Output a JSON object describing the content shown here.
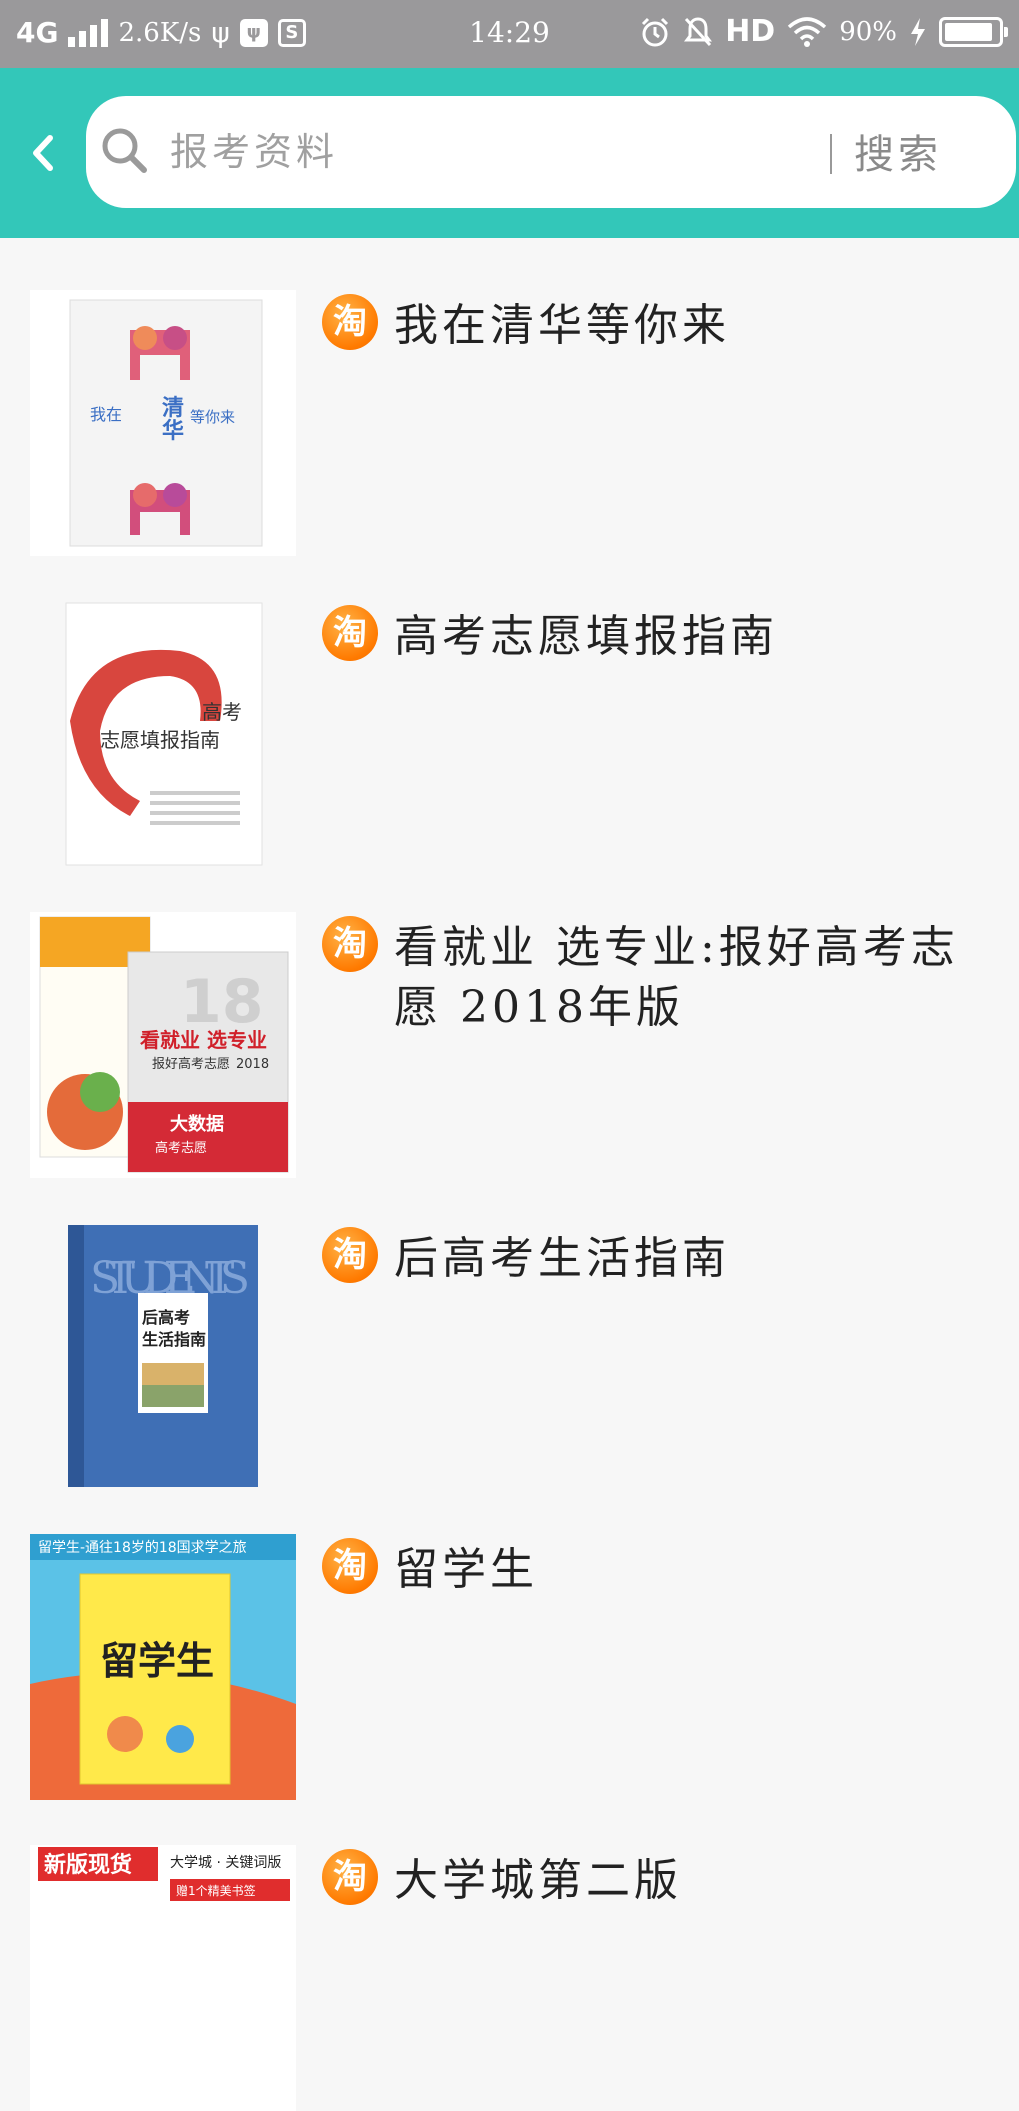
{
  "status_bar": {
    "network": "4G",
    "speed": "2.6K/s",
    "time": "14:29",
    "hd": "HD",
    "battery_percent": "90%",
    "battery_level": 0.9
  },
  "search": {
    "placeholder": "报考资料",
    "button_label": "搜索"
  },
  "results": [
    {
      "title": "我在清华等你来",
      "badge": "淘"
    },
    {
      "title": "高考志愿填报指南",
      "badge": "淘"
    },
    {
      "title": "看就业 选专业:报好高考志愿 2018年版",
      "badge": "淘"
    },
    {
      "title": "后高考生活指南",
      "badge": "淘"
    },
    {
      "title": "留学生",
      "badge": "淘"
    },
    {
      "title": "大学城第二版",
      "badge": "淘"
    }
  ],
  "covers": {
    "cover1": {
      "t1": "我在",
      "t2": "清",
      "t3": "华",
      "t4": "等你来"
    },
    "cover2": {
      "t1": "高考",
      "t2": "志愿填报指南"
    },
    "cover3": {
      "t1": "看就业 选专业",
      "t2": "报好高考志愿",
      "t3": "2018",
      "t4": "大数据",
      "t5": "高考志愿"
    },
    "cover4": {
      "t1": "后高考",
      "t2": "生活指南",
      "t3": "STUDENTS"
    },
    "cover5": {
      "t1": "留学生-通往18岁的18国求学之旅",
      "t2": "留学生"
    },
    "cover6": {
      "t1": "新版现货",
      "t2": "大学城 · 关键词版",
      "t3": "赠1个精美书签"
    }
  },
  "colors": {
    "status_bar": "#9a999b",
    "header": "#33c7b9",
    "taobao_orange": "#ff7a00"
  }
}
